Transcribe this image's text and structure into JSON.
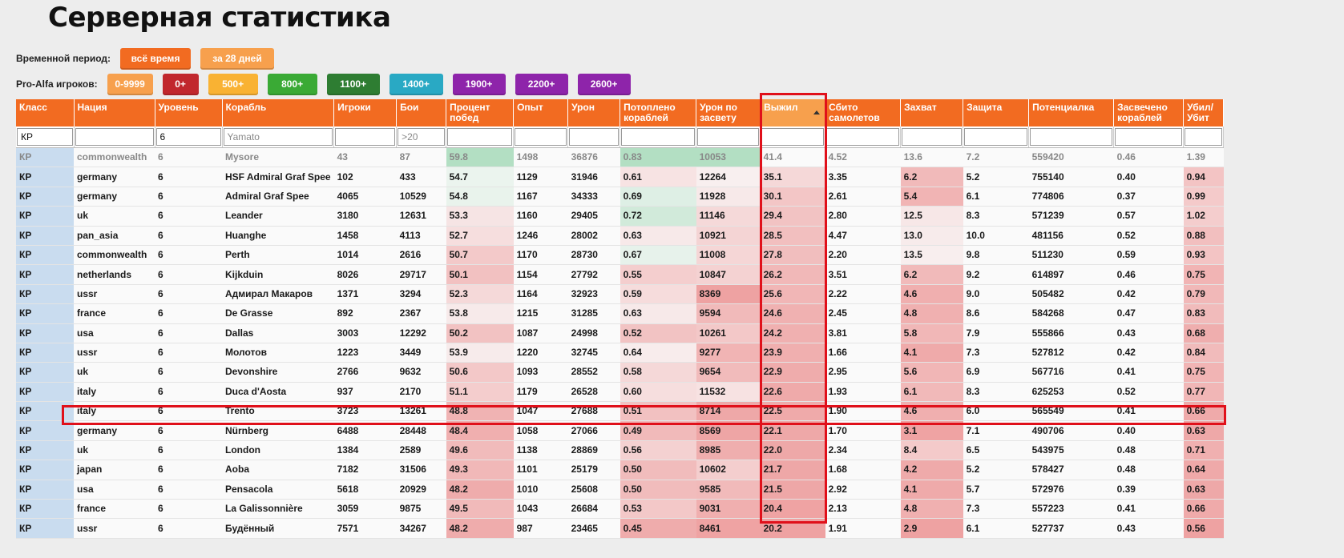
{
  "title": "Серверная статистика",
  "period": {
    "label": "Временной период:",
    "options": [
      {
        "label": "всё время",
        "color": "#f26b21"
      },
      {
        "label": "за 28 дней",
        "color": "#f7a04d"
      }
    ]
  },
  "players": {
    "label": "Pro-Alfa игроков:",
    "options": [
      {
        "label": "0-9999",
        "color": "#f7a04d"
      },
      {
        "label": "0+",
        "color": "#c1272d"
      },
      {
        "label": "500+",
        "color": "#f9b233"
      },
      {
        "label": "800+",
        "color": "#3aaa35"
      },
      {
        "label": "1100+",
        "color": "#2e7d32"
      },
      {
        "label": "1400+",
        "color": "#29a9c4"
      },
      {
        "label": "1900+",
        "color": "#8e24aa"
      },
      {
        "label": "2200+",
        "color": "#8e24aa"
      },
      {
        "label": "2600+",
        "color": "#8e24aa"
      }
    ]
  },
  "table": {
    "columns": [
      "Класс",
      "Нация",
      "Уровень",
      "Корабль",
      "Игроки",
      "Бои",
      "Процент побед",
      "Опыт",
      "Урон",
      "Потоплено кораблей",
      "Урон по засвету",
      "Выжил",
      "Сбито самолетов",
      "Захват",
      "Защита",
      "Потенциалка",
      "Засвечено кораблей",
      "Убил/ Убит"
    ],
    "sorted_column": "Выжил",
    "filters": {
      "class": "КР",
      "nation": "",
      "tier": "6",
      "ship": "",
      "ship_placeholder": "Yamato",
      "players": "",
      "battles": "",
      "battles_placeholder": ">20"
    },
    "rows": [
      [
        "КР",
        "commonwealth",
        "6",
        "Mysore",
        "43",
        "87",
        "59.8",
        "1498",
        "36876",
        "0.83",
        "10053",
        "41.4",
        "4.52",
        "13.6",
        "7.2",
        "559420",
        "0.46",
        "1.39"
      ],
      [
        "КР",
        "germany",
        "6",
        "HSF Admiral Graf Spee",
        "102",
        "433",
        "54.7",
        "1129",
        "31946",
        "0.61",
        "12264",
        "35.1",
        "3.35",
        "6.2",
        "5.2",
        "755140",
        "0.40",
        "0.94"
      ],
      [
        "КР",
        "germany",
        "6",
        "Admiral Graf Spee",
        "4065",
        "10529",
        "54.8",
        "1167",
        "34333",
        "0.69",
        "11928",
        "30.1",
        "2.61",
        "5.4",
        "6.1",
        "774806",
        "0.37",
        "0.99"
      ],
      [
        "КР",
        "uk",
        "6",
        "Leander",
        "3180",
        "12631",
        "53.3",
        "1160",
        "29405",
        "0.72",
        "11146",
        "29.4",
        "2.80",
        "12.5",
        "8.3",
        "571239",
        "0.57",
        "1.02"
      ],
      [
        "КР",
        "pan_asia",
        "6",
        "Huanghe",
        "1458",
        "4113",
        "52.7",
        "1246",
        "28002",
        "0.63",
        "10921",
        "28.5",
        "4.47",
        "13.0",
        "10.0",
        "481156",
        "0.52",
        "0.88"
      ],
      [
        "КР",
        "commonwealth",
        "6",
        "Perth",
        "1014",
        "2616",
        "50.7",
        "1170",
        "28730",
        "0.67",
        "11008",
        "27.8",
        "2.20",
        "13.5",
        "9.8",
        "511230",
        "0.59",
        "0.93"
      ],
      [
        "КР",
        "netherlands",
        "6",
        "Kijkduin",
        "8026",
        "29717",
        "50.1",
        "1154",
        "27792",
        "0.55",
        "10847",
        "26.2",
        "3.51",
        "6.2",
        "9.2",
        "614897",
        "0.46",
        "0.75"
      ],
      [
        "КР",
        "ussr",
        "6",
        "Адмирал Макаров",
        "1371",
        "3294",
        "52.3",
        "1164",
        "32923",
        "0.59",
        "8369",
        "25.6",
        "2.22",
        "4.6",
        "9.0",
        "505482",
        "0.42",
        "0.79"
      ],
      [
        "КР",
        "france",
        "6",
        "De Grasse",
        "892",
        "2367",
        "53.8",
        "1215",
        "31285",
        "0.63",
        "9594",
        "24.6",
        "2.45",
        "4.8",
        "8.6",
        "584268",
        "0.47",
        "0.83"
      ],
      [
        "КР",
        "usa",
        "6",
        "Dallas",
        "3003",
        "12292",
        "50.2",
        "1087",
        "24998",
        "0.52",
        "10261",
        "24.2",
        "3.81",
        "5.8",
        "7.9",
        "555866",
        "0.43",
        "0.68"
      ],
      [
        "КР",
        "ussr",
        "6",
        "Молотов",
        "1223",
        "3449",
        "53.9",
        "1220",
        "32745",
        "0.64",
        "9277",
        "23.9",
        "1.66",
        "4.1",
        "7.3",
        "527812",
        "0.42",
        "0.84"
      ],
      [
        "КР",
        "uk",
        "6",
        "Devonshire",
        "2766",
        "9632",
        "50.6",
        "1093",
        "28552",
        "0.58",
        "9654",
        "22.9",
        "2.95",
        "5.6",
        "6.9",
        "567716",
        "0.41",
        "0.75"
      ],
      [
        "КР",
        "italy",
        "6",
        "Duca d'Aosta",
        "937",
        "2170",
        "51.1",
        "1179",
        "26528",
        "0.60",
        "11532",
        "22.6",
        "1.93",
        "6.1",
        "8.3",
        "625253",
        "0.52",
        "0.77"
      ],
      [
        "КР",
        "italy",
        "6",
        "Trento",
        "3723",
        "13261",
        "48.8",
        "1047",
        "27688",
        "0.51",
        "8714",
        "22.5",
        "1.90",
        "4.6",
        "6.0",
        "565549",
        "0.41",
        "0.66"
      ],
      [
        "КР",
        "germany",
        "6",
        "Nürnberg",
        "6488",
        "28448",
        "48.4",
        "1058",
        "27066",
        "0.49",
        "8569",
        "22.1",
        "1.70",
        "3.1",
        "7.1",
        "490706",
        "0.40",
        "0.63"
      ],
      [
        "КР",
        "uk",
        "6",
        "London",
        "1384",
        "2589",
        "49.6",
        "1138",
        "28869",
        "0.56",
        "8985",
        "22.0",
        "2.34",
        "8.4",
        "6.5",
        "543975",
        "0.48",
        "0.71"
      ],
      [
        "КР",
        "japan",
        "6",
        "Aoba",
        "7182",
        "31506",
        "49.3",
        "1101",
        "25179",
        "0.50",
        "10602",
        "21.7",
        "1.68",
        "4.2",
        "5.2",
        "578427",
        "0.48",
        "0.64"
      ],
      [
        "КР",
        "usa",
        "6",
        "Pensacola",
        "5618",
        "20929",
        "48.2",
        "1010",
        "25608",
        "0.50",
        "9585",
        "21.5",
        "2.92",
        "4.1",
        "5.7",
        "572976",
        "0.39",
        "0.63"
      ],
      [
        "КР",
        "france",
        "6",
        "La Galissonnière",
        "3059",
        "9875",
        "49.5",
        "1043",
        "26684",
        "0.53",
        "9031",
        "20.4",
        "2.13",
        "4.8",
        "7.3",
        "557223",
        "0.41",
        "0.66"
      ],
      [
        "КР",
        "ussr",
        "6",
        "Будённый",
        "7571",
        "34267",
        "48.2",
        "987",
        "23465",
        "0.45",
        "8461",
        "20.2",
        "1.91",
        "2.9",
        "6.1",
        "527737",
        "0.43",
        "0.56"
      ]
    ]
  }
}
